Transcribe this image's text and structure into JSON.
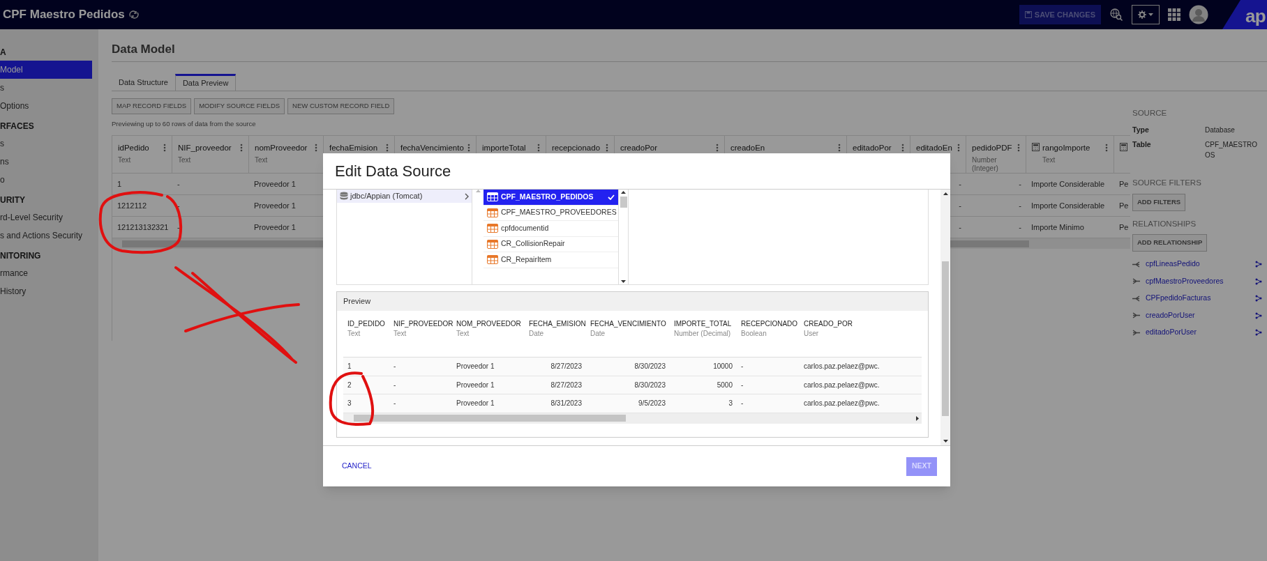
{
  "app_bar": {
    "title": "CPF Maestro Pedidos",
    "save_button": {
      "label": "SAVE CHANGES",
      "disabled": true
    },
    "logo_text": "ap"
  },
  "sidebar": {
    "items": [
      {
        "kind": "header",
        "text": "A"
      },
      {
        "kind": "item",
        "text": "Model",
        "selected": true
      },
      {
        "kind": "item",
        "text": "s",
        "selected": false
      },
      {
        "kind": "item",
        "text": "Options",
        "selected": false
      },
      {
        "kind": "header",
        "text": "RFACES"
      },
      {
        "kind": "item",
        "text": "s",
        "selected": false
      },
      {
        "kind": "item",
        "text": "ns",
        "selected": false
      },
      {
        "kind": "item",
        "text": "o",
        "selected": false
      },
      {
        "kind": "header",
        "text": "URITY"
      },
      {
        "kind": "item",
        "text": "rd-Level Security",
        "selected": false
      },
      {
        "kind": "item",
        "text": "s and Actions Security",
        "selected": false
      },
      {
        "kind": "header",
        "text": "NITORING"
      },
      {
        "kind": "item",
        "text": "rmance",
        "selected": false
      },
      {
        "kind": "item",
        "text": "History",
        "selected": false
      }
    ]
  },
  "page": {
    "title": "Data Model",
    "tabs": [
      {
        "label": "Data Structure",
        "selected": false
      },
      {
        "label": "Data Preview",
        "selected": true
      }
    ],
    "actions": [
      "MAP RECORD FIELDS",
      "MODIFY SOURCE FIELDS",
      "NEW CUSTOM RECORD FIELD"
    ],
    "note": "Previewing up to 60 rows of data from the source",
    "table": {
      "columns": [
        {
          "name": "idPedido",
          "type": "Text"
        },
        {
          "name": "NIF_proveedor",
          "type": "Text"
        },
        {
          "name": "nomProveedor",
          "type": "Text"
        },
        {
          "name": "fechaEmision"
        },
        {
          "name": "fechaVencimiento"
        },
        {
          "name": "importeTotal"
        },
        {
          "name": "recepcionado"
        },
        {
          "name": "creadoPor"
        },
        {
          "name": "creadoEn"
        },
        {
          "name": "editadoPor"
        },
        {
          "name": "editadoEn"
        },
        {
          "name": "pedidoPDF",
          "type": "Number (Integer)"
        },
        {
          "name": "rangoImporte",
          "type": "Text",
          "calculated": true
        },
        {
          "calculated": true
        }
      ],
      "rows": [
        {
          "left_cells": [
            "1",
            "-",
            "Proveedor 1"
          ],
          "right_cells": [
            "-",
            "-",
            "Importe Considerable",
            "Pe"
          ]
        },
        {
          "left_cells": [
            "1212112",
            "-",
            "Proveedor 1"
          ],
          "right_cells": [
            "-",
            "-",
            "Importe Considerable",
            "Pe"
          ]
        },
        {
          "left_cells": [
            "121213132321",
            "-",
            "Proveedor 1"
          ],
          "right_cells": [
            "-",
            "-",
            "Importe Minimo",
            "Pe"
          ]
        }
      ]
    }
  },
  "details": {
    "source_heading": "SOURCE",
    "fields": [
      {
        "label": "Type",
        "value": [
          "Database"
        ]
      },
      {
        "label": "Table",
        "value": [
          "CPF_MAESTRO",
          "OS"
        ]
      }
    ],
    "filters_heading": "SOURCE FILTERS",
    "filters_button": "ADD FILTERS",
    "relationships_heading": "RELATIONSHIPS",
    "relationships_button": "ADD RELATIONSHIP",
    "relationships": [
      {
        "name": "cpfLineasPedido",
        "kind": "one_to_many"
      },
      {
        "name": "cpfMaestroProveedores",
        "kind": "many_to_one"
      },
      {
        "name": "CPFpedidoFacturas",
        "kind": "one_to_many"
      },
      {
        "name": "creadoPorUser",
        "kind": "many_to_one"
      },
      {
        "name": "editadoPorUser",
        "kind": "many_to_one"
      }
    ]
  },
  "dialog": {
    "title": "Edit Data Source",
    "connections": [
      {
        "name": "jdbc/Appian (Tomcat)",
        "selected": true
      }
    ],
    "tables": [
      {
        "name": "CPF_MAESTRO_PEDIDOS",
        "selected": true
      },
      {
        "name": "CPF_MAESTRO_PROVEEDORES",
        "selected": false
      },
      {
        "name": "cpfdocumentid",
        "selected": false
      },
      {
        "name": "CR_CollisionRepair",
        "selected": false
      },
      {
        "name": "CR_RepairItem",
        "selected": false
      }
    ],
    "preview": {
      "title": "Preview",
      "columns": [
        {
          "name": "ID_PEDIDO",
          "type": "Text",
          "kind": "text"
        },
        {
          "name": "NIF_PROVEEDOR",
          "type": "Text",
          "kind": "text"
        },
        {
          "name": "NOM_PROVEEDOR",
          "type": "Text",
          "kind": "text"
        },
        {
          "name": "FECHA_EMISION",
          "type": "Date",
          "kind": "date"
        },
        {
          "name": "FECHA_VENCIMIENTO",
          "type": "Date",
          "kind": "date"
        },
        {
          "name": "IMPORTE_TOTAL",
          "type": "Number (Decimal)",
          "kind": "number"
        },
        {
          "name": "RECEPCIONADO",
          "type": "Boolean",
          "kind": "boolean"
        },
        {
          "name": "CREADO_POR",
          "type": "User",
          "kind": "user"
        }
      ],
      "rows": [
        [
          "1",
          "-",
          "Proveedor 1",
          "8/27/2023",
          "8/30/2023",
          "10000",
          "-",
          "carlos.paz.pelaez@pwc."
        ],
        [
          "2",
          "-",
          "Proveedor 1",
          "8/27/2023",
          "8/30/2023",
          "5000",
          "-",
          "carlos.paz.pelaez@pwc."
        ],
        [
          "3",
          "-",
          "Proveedor 1",
          "8/31/2023",
          "9/5/2023",
          "3",
          "-",
          "carlos.paz.pelaez@pwc."
        ]
      ]
    },
    "cancel": "CANCEL",
    "next": {
      "label": "NEXT",
      "disabled": true
    }
  }
}
